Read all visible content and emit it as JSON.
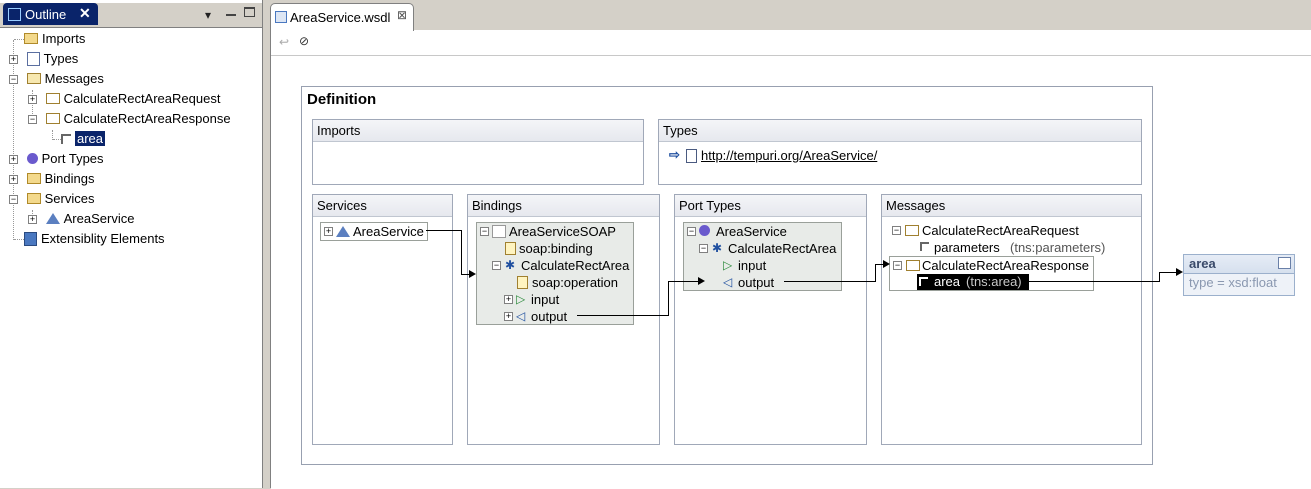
{
  "outline": {
    "tab_label": "Outline",
    "tree": [
      {
        "label": "Imports"
      },
      {
        "label": "Types"
      },
      {
        "label": "Messages"
      },
      {
        "label": "CalculateRectAreaRequest"
      },
      {
        "label": "CalculateRectAreaResponse"
      },
      {
        "label": "area"
      },
      {
        "label": "Port Types"
      },
      {
        "label": "Bindings"
      },
      {
        "label": "Services"
      },
      {
        "label": "AreaService"
      },
      {
        "label": "Extensiblity Elements"
      }
    ]
  },
  "editor": {
    "tab_label": "AreaService.wsdl",
    "definition_title": "Definition",
    "imports_title": "Imports",
    "types": {
      "title": "Types",
      "link": "http://tempuri.org/AreaService/"
    },
    "services": {
      "title": "Services",
      "item": "AreaService"
    },
    "bindings": {
      "title": "Bindings",
      "binding": "AreaServiceSOAP",
      "soap_binding": "soap:binding",
      "operation": "CalculateRectArea",
      "soap_operation": "soap:operation",
      "input": "input",
      "output": "output"
    },
    "port_types": {
      "title": "Port Types",
      "port_type": "AreaService",
      "operation": "CalculateRectArea",
      "input": "input",
      "output": "output"
    },
    "messages": {
      "title": "Messages",
      "request": "CalculateRectAreaRequest",
      "request_part": "parameters",
      "request_part_type": "(tns:parameters)",
      "response": "CalculateRectAreaResponse",
      "response_part": "area",
      "response_part_type": "(tns:area)"
    },
    "element": {
      "name": "area",
      "type": "type = xsd:float"
    }
  },
  "colors": {
    "selection": "#0a246a",
    "box_border": "#a0a8b8",
    "node_fill": "#e8ebe8"
  }
}
